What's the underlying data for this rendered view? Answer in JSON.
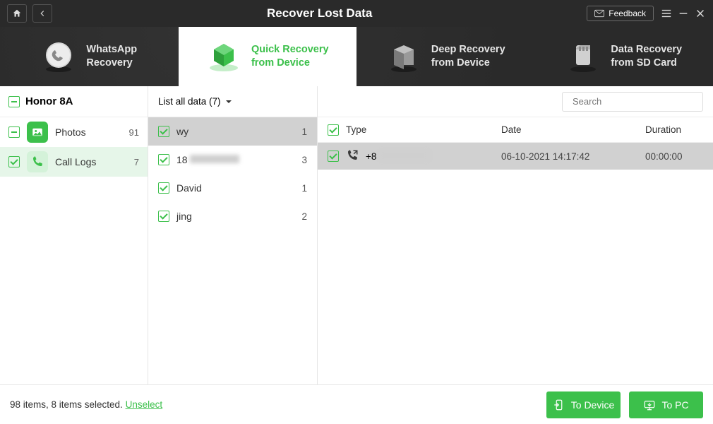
{
  "title": "Recover Lost Data",
  "feedback": "Feedback",
  "tabs": [
    {
      "l1": "WhatsApp",
      "l2": "Recovery"
    },
    {
      "l1": "Quick Recovery",
      "l2": "from Device"
    },
    {
      "l1": "Deep Recovery",
      "l2": "from Device"
    },
    {
      "l1": "Data Recovery",
      "l2": "from SD Card"
    }
  ],
  "device": "Honor 8A",
  "side": {
    "photos": {
      "label": "Photos",
      "count": "91"
    },
    "calllogs": {
      "label": "Call Logs",
      "count": "7"
    }
  },
  "filter": "List all data (7)",
  "contacts": [
    {
      "name": "wy",
      "count": "1"
    },
    {
      "name": "18",
      "count": "3"
    },
    {
      "name": "David",
      "count": "1"
    },
    {
      "name": "jing",
      "count": "2"
    }
  ],
  "search": {
    "placeholder": "Search"
  },
  "columns": {
    "type": "Type",
    "date": "Date",
    "duration": "Duration"
  },
  "rows": [
    {
      "num": "+8",
      "date": "06-10-2021 14:17:42",
      "dur": "00:00:00"
    }
  ],
  "status": {
    "text": "98 items, 8 items selected. ",
    "link": "Unselect"
  },
  "buttons": {
    "device": "To Device",
    "pc": "To PC"
  }
}
